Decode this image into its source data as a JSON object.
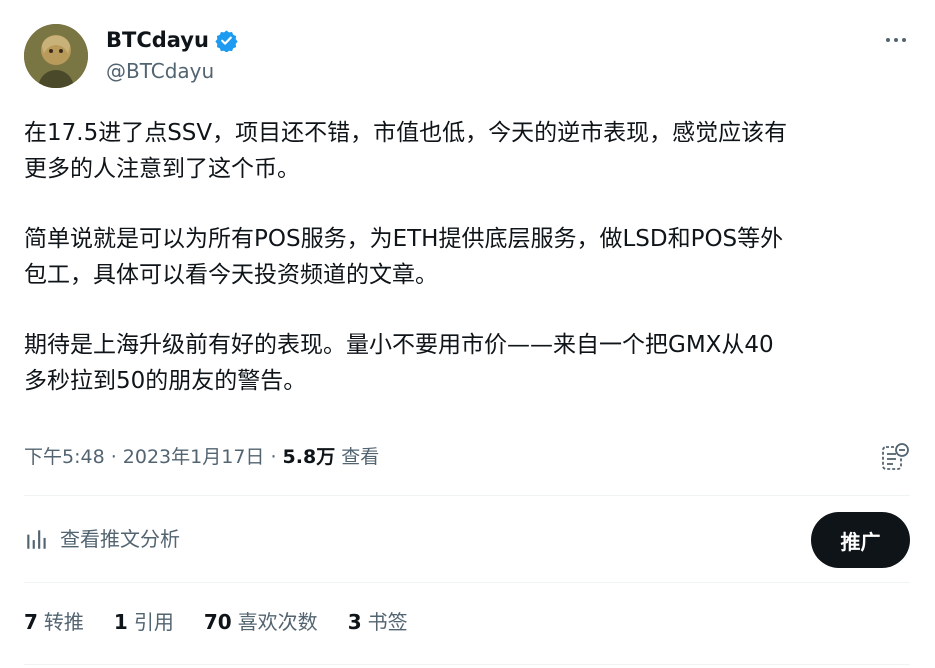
{
  "author": {
    "name": "BTCdayu",
    "handle": "@BTCdayu",
    "verified_color": "#1d9bf0"
  },
  "tweet": {
    "paragraphs": [
      "在17.5进了点SSV，项目还不错，市值也低，今天的逆市表现，感觉应该有\n更多的人注意到了这个币。",
      "简单说就是可以为所有POS服务，为ETH提供底层服务，做LSD和POS等外\n包工，具体可以看今天投资频道的文章。",
      "期待是上海升级前有好的表现。量小不要用市价——来自一个把GMX从40\n多秒拉到50的朋友的警告。"
    ]
  },
  "meta": {
    "time": "下午5:48",
    "separator1": " · ",
    "date": "2023年1月17日",
    "separator2": " · ",
    "views_count": "5.8万",
    "views_label": " 查看"
  },
  "actions": {
    "analytics_label": "查看推文分析",
    "promote_label": "推广"
  },
  "stats": [
    {
      "count": "7",
      "label": "转推"
    },
    {
      "count": "1",
      "label": "引用"
    },
    {
      "count": "70",
      "label": "喜欢次数"
    },
    {
      "count": "3",
      "label": "书签"
    }
  ],
  "icons": {
    "verified": "verified-badge-icon",
    "more": "more-options-icon",
    "analytics": "analytics-icon",
    "note": "bookmark-note-icon"
  }
}
